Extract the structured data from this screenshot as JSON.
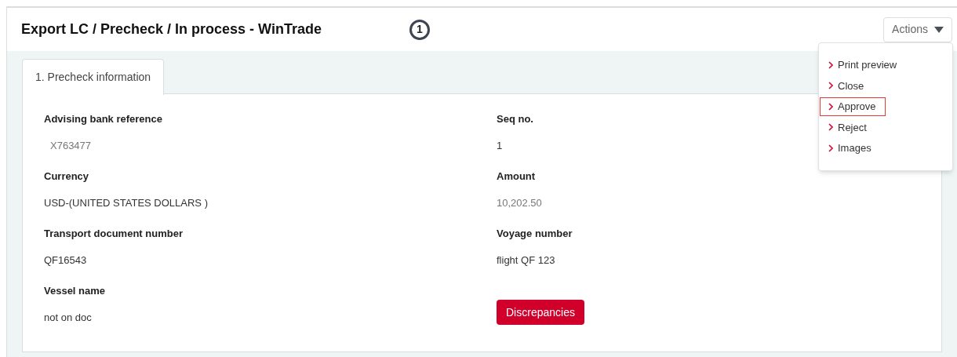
{
  "page": {
    "title": "Export LC / Precheck / In process - WinTrade",
    "step_badge": "1"
  },
  "actions": {
    "label": "Actions",
    "expanded": true,
    "items": [
      {
        "label": "Print preview",
        "highlighted": false
      },
      {
        "label": "Close",
        "highlighted": false
      },
      {
        "label": "Approve",
        "highlighted": true
      },
      {
        "label": "Reject",
        "highlighted": false
      },
      {
        "label": "Images",
        "highlighted": false
      }
    ]
  },
  "tabs": [
    {
      "label": "1. Precheck information",
      "selected": true
    }
  ],
  "fields": [
    {
      "label": "Advising bank reference",
      "value": "X763477",
      "greyed": true
    },
    {
      "label": "Seq no.",
      "value": "1",
      "greyed": false
    },
    {
      "label": "Currency",
      "value": "USD-(UNITED STATES DOLLARS )",
      "greyed": false
    },
    {
      "label": "Amount",
      "value": "10,202.50",
      "greyed": true
    },
    {
      "label": "Transport document number",
      "value": "QF16543",
      "greyed": false
    },
    {
      "label": "Voyage number",
      "value": "flight QF 123",
      "greyed": false
    },
    {
      "label": "Vessel name",
      "value": "not on doc",
      "greyed": false
    }
  ],
  "discrepancies_button": "Discrepancies"
}
